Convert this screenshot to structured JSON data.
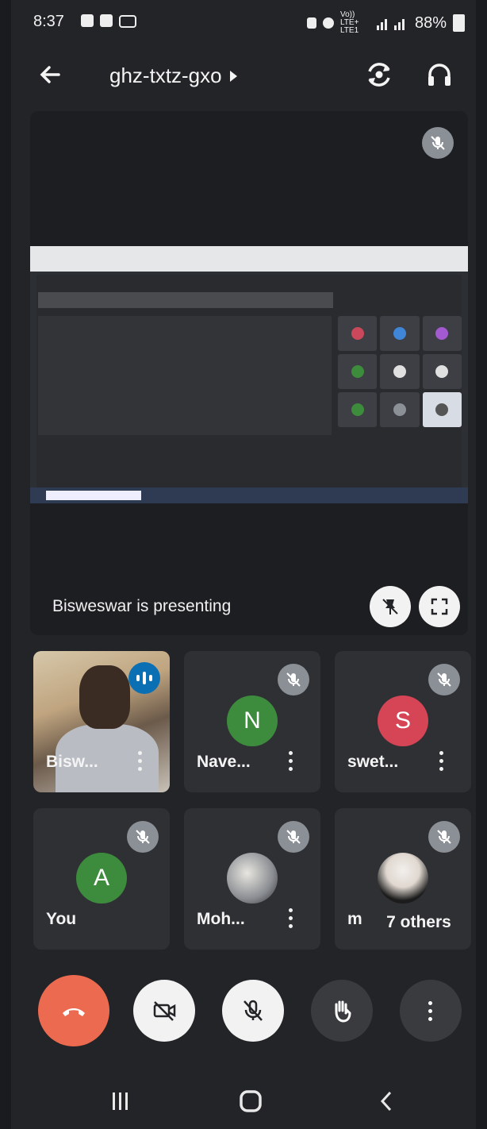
{
  "status_bar": {
    "time": "8:37",
    "network": "Vo)) LTE+ LTE1",
    "battery": "88%"
  },
  "header": {
    "meeting_code": "ghz-txtz-gxo"
  },
  "presentation": {
    "caption": "Bisweswar is presenting"
  },
  "participants": [
    {
      "name": "Bisw...",
      "avatar_letter": "",
      "speaking": true,
      "muted": false,
      "color": ""
    },
    {
      "name": "Nave...",
      "avatar_letter": "N",
      "muted": true,
      "color": "#3d8b3d"
    },
    {
      "name": "swet...",
      "avatar_letter": "S",
      "muted": true,
      "color": "#d64556"
    },
    {
      "name": "You",
      "avatar_letter": "A",
      "muted": true,
      "color": "#3d8b3d"
    },
    {
      "name": "Moh...",
      "avatar_letter": "",
      "muted": true,
      "color": ""
    },
    {
      "name": "m",
      "avatar_letter": "",
      "muted": true,
      "color": ""
    }
  ],
  "others_label": "7 others",
  "colors": {
    "end_call": "#ec6a4f",
    "control_light": "#f2f2f2",
    "control_dark": "#3a3b3f"
  }
}
